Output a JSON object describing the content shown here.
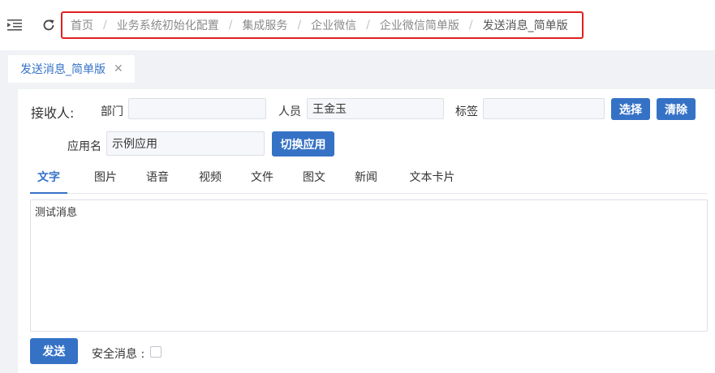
{
  "breadcrumb": [
    "首页",
    "业务系统初始化配置",
    "集成服务",
    "企业微信",
    "企业微信简单版",
    "发送消息_简单版"
  ],
  "breadcrumb_separator": "/",
  "tab": {
    "label": "发送消息_简单版",
    "close": "✕"
  },
  "form": {
    "receiver_label": "接收人:",
    "dept_label": "部门",
    "dept_value": "",
    "person_label": "人员",
    "person_value": "王金玉",
    "tag_label": "标签",
    "tag_value": "",
    "select_button": "选择",
    "clear_button": "清除",
    "app_label": "应用名",
    "app_value": "示例应用",
    "switch_app_button": "切换应用"
  },
  "msg_tabs": [
    "文字",
    "图片",
    "语音",
    "视频",
    "文件",
    "图文",
    "新闻",
    "文本卡片"
  ],
  "active_tab": "文字",
  "message_text": "测试消息",
  "send_button": "发送",
  "secure_label": "安全消息 :",
  "secure_checked": false,
  "colors": {
    "accent": "#3572c6",
    "highlight_border": "#e02020"
  }
}
